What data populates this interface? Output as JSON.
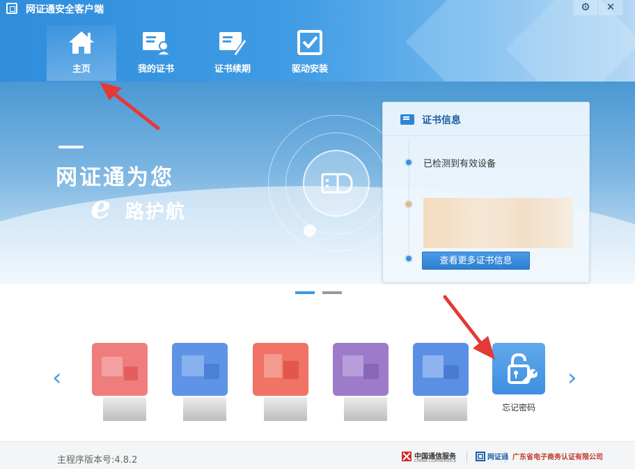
{
  "app": {
    "title": "网证通安全客户端"
  },
  "window_controls": [
    {
      "name": "settings",
      "glyph": "⚙"
    },
    {
      "name": "close",
      "glyph": "✕"
    }
  ],
  "nav": [
    {
      "label": "主页",
      "icon": "home-icon",
      "active": true
    },
    {
      "label": "我的证书",
      "icon": "certificate-user-icon",
      "active": false
    },
    {
      "label": "证书续期",
      "icon": "certificate-renew-icon",
      "active": false
    },
    {
      "label": "驱动安装",
      "icon": "driver-install-icon",
      "active": false
    }
  ],
  "banner": {
    "slogan_line1": "网证通为您",
    "slogan_e": "e",
    "slogan_line2": "路护航"
  },
  "cert_panel": {
    "title": "证书信息",
    "status": "已检测到有效设备",
    "more_button": "查看更多证书信息"
  },
  "tiles": {
    "left_arrow": "‹",
    "right_arrow": "›",
    "forgot_password_label": "忘记密码"
  },
  "footer": {
    "version": "主程序版本号:4.8.2",
    "partners": [
      {
        "name": "中国通信服务",
        "sub": "CHINA COMSERVICE"
      },
      {
        "name": "网证通",
        "sub": ""
      },
      {
        "name": "广东省电子商务认证有限公司",
        "sub": ""
      }
    ]
  },
  "colors": {
    "header_blue": "#2f8ddc",
    "accent": "#2c86d6",
    "annotation_red": "#e53935"
  }
}
